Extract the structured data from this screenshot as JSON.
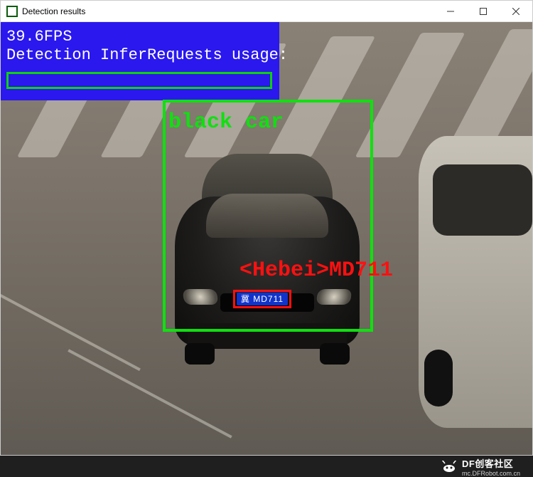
{
  "window": {
    "title": "Detection results",
    "controls": {
      "minimize": "—",
      "maximize": "▢",
      "close": "✕"
    }
  },
  "overlay": {
    "fps_line": "39.6FPS",
    "usage_line": "Detection InferRequests usage:"
  },
  "detections": {
    "vehicle": {
      "label": "black car",
      "bbox_color": "#10e010"
    },
    "plate": {
      "ocr_text": "<Hebei>MD711",
      "plate_display": "冀 MD711",
      "bbox_color": "#ff1010"
    }
  },
  "footer": {
    "brand": "DF创客社区",
    "url": "mc.DFRobot.com.cn"
  }
}
